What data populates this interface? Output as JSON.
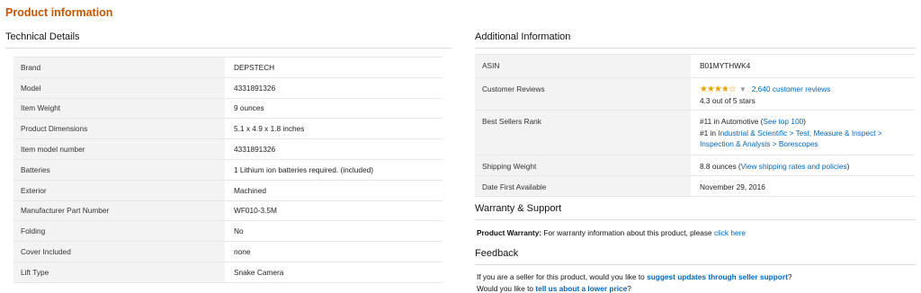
{
  "page": {
    "section_title": "Product information"
  },
  "technical": {
    "title": "Technical Details",
    "rows": [
      {
        "label": "Brand",
        "value": "DEPSTECH",
        "link": false
      },
      {
        "label": "Model",
        "value": "4331891326",
        "link": false
      },
      {
        "label": "Item Weight",
        "value": "9 ounces",
        "link": false
      },
      {
        "label": "Product Dimensions",
        "value": "5.1 x 4.9 x 1.8 inches",
        "link": false
      },
      {
        "label": "Item model number",
        "value": "4331891326",
        "link": false
      },
      {
        "label": "Batteries",
        "value": "1 Lithium ion batteries required. (included)",
        "link": false
      },
      {
        "label": "Exterior",
        "value": "Machined",
        "link": true
      },
      {
        "label": "Manufacturer Part Number",
        "value": "WF010-3.5M",
        "link": false
      },
      {
        "label": "Folding",
        "value": "No",
        "link": true
      },
      {
        "label": "Cover Included",
        "value": "none",
        "link": true
      },
      {
        "label": "Lift Type",
        "value": "Snake Camera",
        "link": true
      }
    ]
  },
  "additional": {
    "title": "Additional Information",
    "asin": {
      "label": "ASIN",
      "value": "B01MYTHWK4"
    },
    "reviews": {
      "label": "Customer Reviews",
      "stars": "★★★★☆",
      "rating": 4.3,
      "count_link": "2,640 customer reviews",
      "rating_text": "4.3 out of 5 stars"
    },
    "rank": {
      "label": "Best Sellers Rank",
      "line1_text": "#11 in Automotive (",
      "line1_link": "See top 100",
      "line1_end": ")",
      "line2_text": "#1 in ",
      "line2_link": "Industrial & Scientific > Test, Measure & Inspect > Inspection & Analysis > Borescopes"
    },
    "shipping": {
      "label": "Shipping Weight",
      "value": "8.8 ounces (",
      "link": "View shipping rates and policies",
      "end": ")"
    },
    "date": {
      "label": "Date First Available",
      "value": "November 29, 2016"
    }
  },
  "warranty": {
    "title": "Warranty & Support",
    "bold": "Product Warranty:",
    "text": " For warranty information about this product, please ",
    "link": "click here"
  },
  "feedback": {
    "title": "Feedback",
    "line1_text": "If you are a seller for this product, would you like to ",
    "line1_link": "suggest updates through seller support",
    "line1_end": "?",
    "line2_text": "Would you like to ",
    "line2_link": "tell us about a lower price",
    "line2_end": "?"
  },
  "colors": {
    "accent": "#c45500",
    "link": "#0066c0",
    "label_bg": "#f3f3f3",
    "star": "#f0a000"
  }
}
